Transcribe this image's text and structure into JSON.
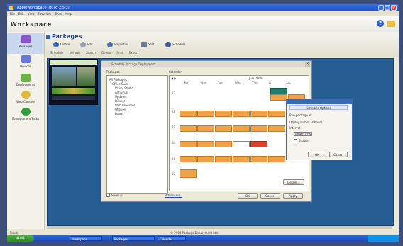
{
  "app": {
    "title": "AppleWorkspace (build 2.5.3)",
    "menu": [
      "File",
      "Edit",
      "View",
      "Favorites",
      "Tools",
      "Help"
    ]
  },
  "workspace": {
    "title": "Workspace"
  },
  "left_nav": {
    "items": [
      {
        "label": "Packages",
        "icon": "packages-icon",
        "color": "#8b55c9"
      },
      {
        "label": "Devices",
        "icon": "devices-icon",
        "color": "#6a78d6"
      },
      {
        "label": "Deployments",
        "icon": "deployments-icon",
        "color": "#6fb24a"
      },
      {
        "label": "Web Console",
        "icon": "web-console-icon",
        "color": "#e0b93a"
      },
      {
        "label": "Management Tasks",
        "icon": "management-icon",
        "color": "#2f9e3c"
      }
    ]
  },
  "packages": {
    "title": "Packages",
    "toolbar": [
      {
        "label": "Create",
        "color": "#3e6bcc"
      },
      {
        "label": "Edit",
        "color": "#9aa1b1"
      },
      {
        "label": "Properties",
        "color": "#4f6ea8"
      },
      {
        "label": "Sort",
        "color": "#6b7a94"
      },
      {
        "label": "Schedule",
        "color": "#3b5a9a"
      }
    ],
    "subtoolbar": [
      "Schedule",
      "Refresh",
      "Search",
      "Delete",
      "Print",
      "Export"
    ]
  },
  "dialog": {
    "title": "Schedule Package Deployment",
    "left_label": "Packages",
    "right_label": "Calendar",
    "tree": [
      "All Packages",
      "Office Suite",
      "Visual Studio",
      "Antivirus",
      "Updates",
      "Drivers",
      "Web Browsers",
      "Utilities",
      "Fonts"
    ],
    "show_all_label": "Show all",
    "link": "Advanced...",
    "buttons": {
      "details": "Details...",
      "ok": "OK",
      "cancel": "Cancel",
      "apply": "Apply"
    }
  },
  "calendar": {
    "nav": "◀ ▶",
    "month": "July 2008",
    "days": [
      "Sun",
      "Mon",
      "Tue",
      "Wed",
      "Thu",
      "Fri",
      "Sat"
    ],
    "weeks": [
      "27",
      "28",
      "29",
      "30",
      "31",
      "32"
    ]
  },
  "popup": {
    "tab": "Schedule Options",
    "line1": "Run package at:",
    "line2": "Deploy within 24 hours",
    "line3": "Interval:",
    "field_value": "2008/07/06",
    "check_label": "Enable",
    "ok": "OK",
    "cancel": "Cancel"
  },
  "statusbar": {
    "left": "Ready",
    "center": "© 2008 Package Deployment Ltd."
  },
  "taskbar": {
    "start": "start",
    "items": [
      "Workspace",
      "Packages",
      "Calendar"
    ]
  }
}
